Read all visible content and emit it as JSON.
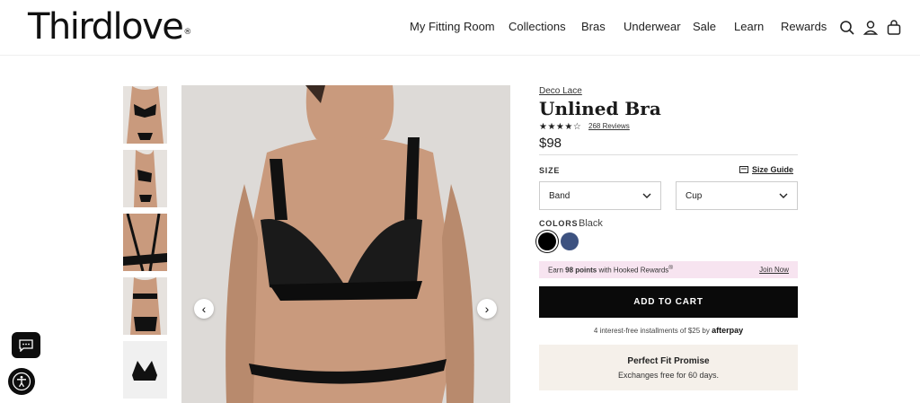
{
  "brand": {
    "logo_text": "Thirdlove",
    "trademark": "®"
  },
  "nav": {
    "items": [
      "My Fitting Room",
      "Collections",
      "Bras",
      "Underwear",
      "Sale",
      "Learn",
      "Rewards"
    ],
    "icons": [
      "search-icon",
      "account-icon",
      "bag-icon"
    ]
  },
  "gallery": {
    "thumbnails": [
      "front-view",
      "side-view",
      "back-strap-view",
      "back-view",
      "flat-lay"
    ],
    "prev_arrow": "‹",
    "next_arrow": "›"
  },
  "product": {
    "collection": "Deco Lace",
    "title": "Unlined Bra",
    "stars": "★★★★☆",
    "rating": 4.5,
    "reviews": "268 Reviews",
    "price": "$98"
  },
  "size": {
    "label": "SIZE",
    "guide": "Size Guide",
    "band_value": "Band",
    "cup_value": "Cup"
  },
  "colors": {
    "label": "COLORS",
    "selected": "Black",
    "swatches": [
      "#000000",
      "#3d5280"
    ]
  },
  "rewards": {
    "prefix": "Earn ",
    "points": "98 points",
    "suffix": " with Hooked Rewards",
    "sup": "®",
    "join": "Join Now"
  },
  "cart": {
    "label": "ADD TO CART"
  },
  "afterpay": {
    "text": "4 interest-free installments of $25 by ",
    "brand": "afterpay"
  },
  "promise": {
    "title": "Perfect Fit Promise",
    "subtitle": "Exchanges free for 60 days."
  },
  "colors_theme": {
    "accent": "#0a0a0a",
    "rewards_bg": "#f7e4f0",
    "promise_bg": "#f5f0ea"
  }
}
